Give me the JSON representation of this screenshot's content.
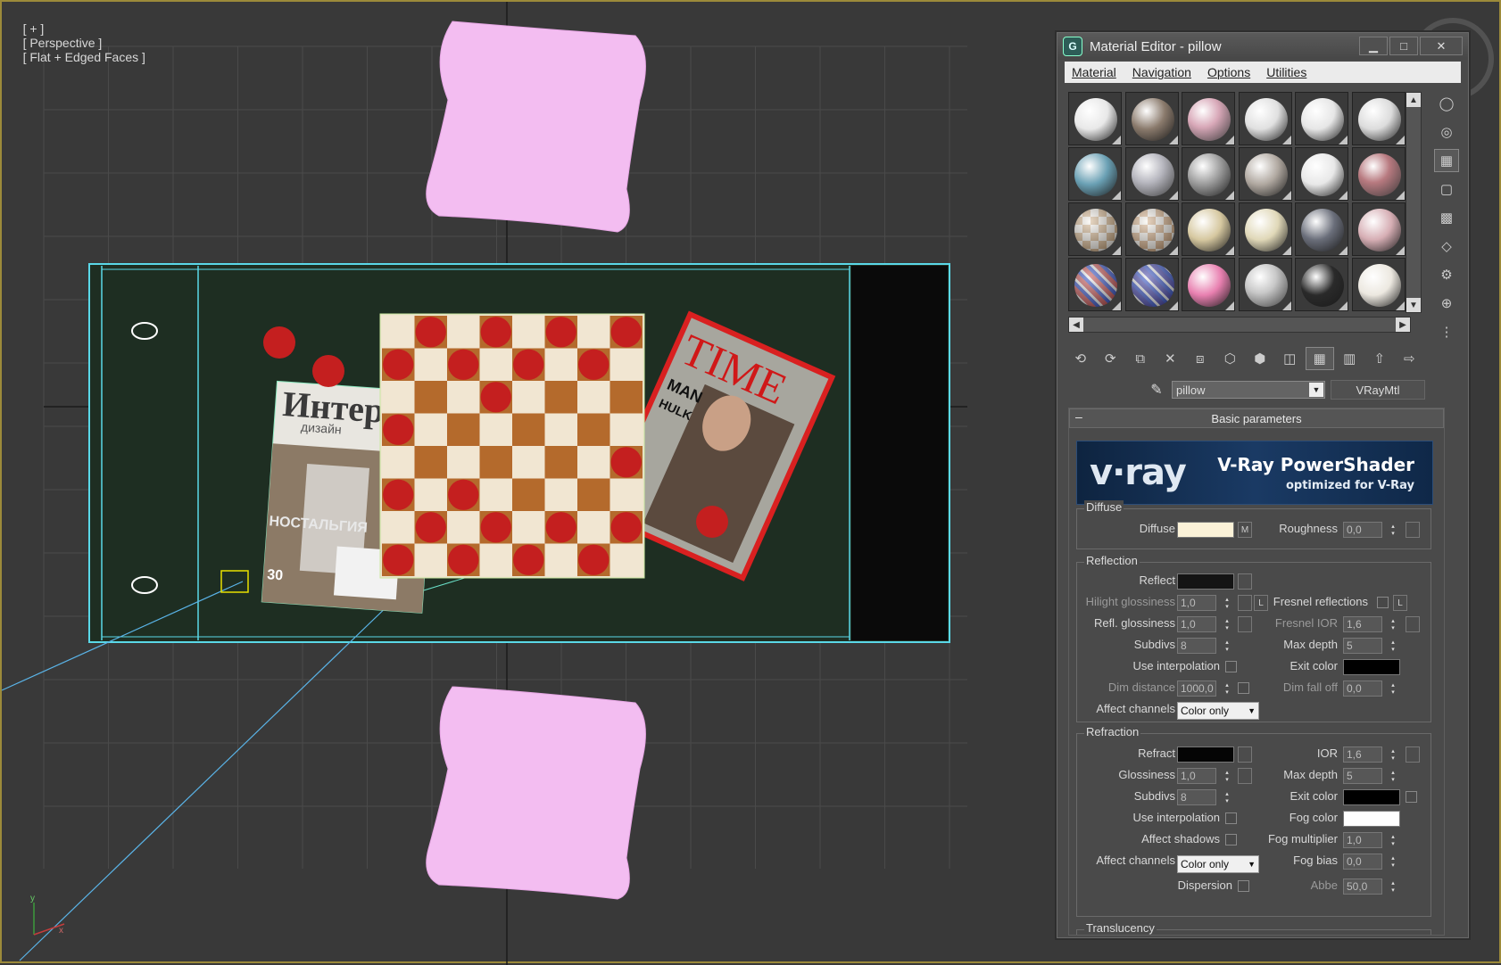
{
  "viewport": {
    "labels": [
      "[ + ]",
      "[ Perspective ]",
      "[ Flat + Edged Faces ]"
    ],
    "axis_y": "y",
    "axis_x": "x",
    "colors": {
      "grid": "#4a4a4a",
      "background": "#393939",
      "selection": "#5ad8e8",
      "table": "#1e2e22",
      "pillow": "#f0b8ee"
    }
  },
  "scene": {
    "magazine_left": {
      "title": "Интер",
      "subtitle": "дизайн",
      "headline": "НОСТАЛЬГИЯ",
      "number": "30"
    },
    "magazine_right": {
      "title": "TIME",
      "headline_1": "MAN",
      "headline_2": "HULK"
    },
    "checkers": {
      "rows": 8,
      "cols": 8
    }
  },
  "material_editor": {
    "title": "Material Editor - pillow",
    "app_icon": "G",
    "window_buttons": [
      "▁",
      "□",
      "✕"
    ],
    "menu": [
      "Material",
      "Navigation",
      "Options",
      "Utilities"
    ],
    "slots": [
      {
        "color": "#e8e8e8",
        "kind": "plain"
      },
      {
        "color": "#8a7a6c",
        "kind": "plain"
      },
      {
        "color": "#d8a8b8",
        "kind": "fabric"
      },
      {
        "color": "#e0e0e0",
        "kind": "tick"
      },
      {
        "color": "#e6e6e6",
        "kind": "tick"
      },
      {
        "color": "#dcdcdc",
        "kind": "spots"
      },
      {
        "color": "#6aa0b4",
        "kind": "plain"
      },
      {
        "color": "#b8b8c0",
        "kind": "mag"
      },
      {
        "color": "#9a9a9a",
        "kind": "plain"
      },
      {
        "color": "#b0a8a0",
        "kind": "plain"
      },
      {
        "color": "#e8e8e8",
        "kind": "plain"
      },
      {
        "color": "#b87a80",
        "kind": "mag"
      },
      {
        "color": "#c8a070",
        "kind": "checker"
      },
      {
        "color": "#c89868",
        "kind": "checker"
      },
      {
        "color": "#d6c8a0",
        "kind": "plain"
      },
      {
        "color": "#e0d8b8",
        "kind": "plain"
      },
      {
        "color": "#6a6e7a",
        "kind": "plain"
      },
      {
        "color": "#d6aeb4",
        "kind": "plain"
      },
      {
        "color": "#c04040",
        "kind": "stripes"
      },
      {
        "color": "#3030a0",
        "kind": "stripes"
      },
      {
        "color": "#e880b0",
        "kind": "plain"
      },
      {
        "color": "#c8c8c8",
        "kind": "room"
      },
      {
        "color": "#2a2a2a",
        "kind": "plain"
      },
      {
        "color": "#ece8e0",
        "kind": "plain"
      }
    ],
    "scroll_up": "▲",
    "scroll_down": "▼",
    "scroll_left": "◀",
    "scroll_right": "▶",
    "side_tools": [
      "sample-type-icon",
      "backlight-icon",
      "background-icon",
      "uv-tiling-icon",
      "video-check-icon",
      "preview-icon",
      "options-icon",
      "select-by-material-icon",
      "material-navigator-icon"
    ],
    "toolbar": [
      "get-material-icon",
      "put-to-scene-icon",
      "assign-to-selection-icon",
      "reset-map-icon",
      "copy-material-icon",
      "make-unique-icon",
      "put-to-library-icon",
      "material-id-icon",
      "show-map-icon",
      "show-end-result-icon",
      "go-to-parent-icon",
      "go-forward-icon"
    ],
    "name_value": "pillow",
    "type_label": "VRayMtl",
    "rollout_title": "Basic parameters",
    "rollout_toggle": "–",
    "banner": {
      "logo": "v·ray",
      "title": "V-Ray PowerShader",
      "subtitle": "optimized for V-Ray"
    },
    "diffuse": {
      "group": "Diffuse",
      "diffuse_label": "Diffuse",
      "diffuse_color": "#fbf2d8",
      "map_btn": "M",
      "roughness_label": "Roughness",
      "roughness_value": "0,0"
    },
    "reflection": {
      "group": "Reflection",
      "reflect_label": "Reflect",
      "reflect_color": "#141414",
      "hilight_label": "Hilight glossiness",
      "hilight_value": "1,0",
      "lock": "L",
      "fresnel_label": "Fresnel reflections",
      "fresnel_lock": "L",
      "refl_gloss_label": "Refl. glossiness",
      "refl_gloss_value": "1,0",
      "fresnel_ior_label": "Fresnel IOR",
      "fresnel_ior_value": "1,6",
      "subdivs_label": "Subdivs",
      "subdivs_value": "8",
      "max_depth_label": "Max depth",
      "max_depth_value": "5",
      "use_interp_label": "Use interpolation",
      "exit_color_label": "Exit color",
      "exit_color": "#000000",
      "dim_distance_label": "Dim distance",
      "dim_distance_value": "1000,0",
      "dim_falloff_label": "Dim fall off",
      "dim_falloff_value": "0,0",
      "affect_channels_label": "Affect channels",
      "affect_channels_value": "Color only"
    },
    "refraction": {
      "group": "Refraction",
      "refract_label": "Refract",
      "refract_color": "#050505",
      "ior_label": "IOR",
      "ior_value": "1,6",
      "glossiness_label": "Glossiness",
      "glossiness_value": "1,0",
      "max_depth_label": "Max depth",
      "max_depth_value": "5",
      "subdivs_label": "Subdivs",
      "subdivs_value": "8",
      "exit_color_label": "Exit color",
      "exit_color": "#000000",
      "use_interp_label": "Use interpolation",
      "fog_color_label": "Fog color",
      "fog_color": "#ffffff",
      "affect_shadows_label": "Affect shadows",
      "fog_mult_label": "Fog multiplier",
      "fog_mult_value": "1,0",
      "affect_channels_label": "Affect channels",
      "affect_channels_value": "Color only",
      "fog_bias_label": "Fog bias",
      "fog_bias_value": "0,0",
      "dispersion_label": "Dispersion",
      "abbe_label": "Abbe",
      "abbe_value": "50,0"
    },
    "translucency_group": "Translucency"
  }
}
